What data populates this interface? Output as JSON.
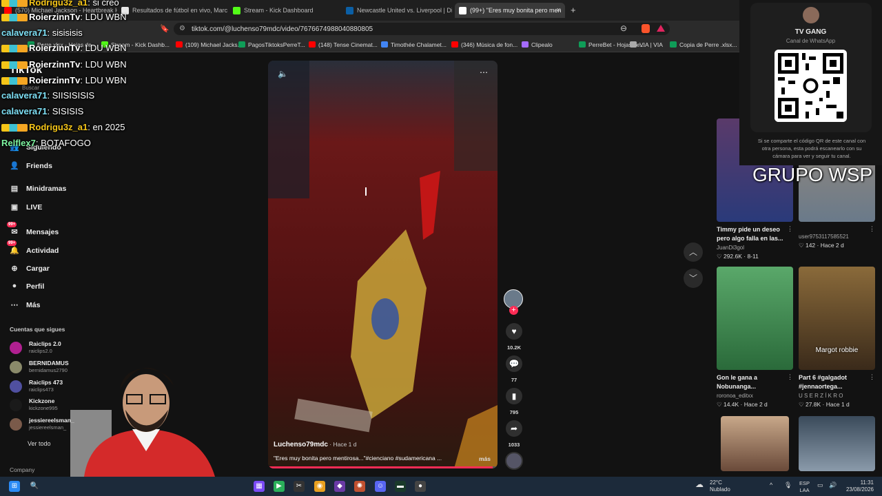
{
  "browser": {
    "tabs": [
      {
        "title": "(570) Michael Jackson - Heartbreak H",
        "favicon_color": "#ff0000"
      },
      {
        "title": "Resultados de fútbol en vivo, Marcad",
        "favicon_color": "#e8e8e8"
      },
      {
        "title": "Stream - Kick Dashboard",
        "favicon_color": "#53fc18"
      },
      {
        "title": "Newcastle United vs. Liverpool | Disne",
        "favicon_color": "#0b5fa5"
      },
      {
        "title": "(99+) \"Eres muy bonita pero men",
        "favicon_color": "#ffffff",
        "active": true
      }
    ],
    "url": "tiktok.com/@luchenso79mdc/video/7676674988040880805",
    "bookmarks": [
      {
        "label": "Perre.xlsx - Hojas de...",
        "color": "#0f9d58"
      },
      {
        "label": "Stream - Kick Dashb...",
        "color": "#53fc18"
      },
      {
        "label": "(109) Michael Jacks...",
        "color": "#ff0000"
      },
      {
        "label": "PagosTiktoksPerreT...",
        "color": "#0f9d58"
      },
      {
        "label": "(148) Tense Cinemat...",
        "color": "#ff0000"
      },
      {
        "label": "Timothée Chalamet...",
        "color": "#4285f4"
      },
      {
        "label": "(346) Música de fon...",
        "color": "#ff0000"
      },
      {
        "label": "Clipealo",
        "color": "#a66cff"
      },
      {
        "label": "PerreBet - Hojas de...",
        "color": "#0f9d58"
      },
      {
        "label": "VIA | VIA",
        "color": "#aaaaaa"
      },
      {
        "label": "Copia de Perre .xlsx...",
        "color": "#0f9d58"
      }
    ]
  },
  "chat": [
    {
      "user": "Rodrigu3z_a1",
      "text": ": si creo",
      "color": "#f5c518",
      "badges": true
    },
    {
      "user": "calavera71",
      "text": ": sisisisis",
      "color": "#7ee0f5",
      "badges": false
    },
    {
      "user": "RoierzinnTv",
      "text": ": LDU WBN",
      "color": "#ffffff",
      "badges": true
    },
    {
      "user": "RoierzinnTv",
      "text": ": LDU WBN",
      "color": "#ffffff",
      "badges": true
    },
    {
      "user": "RoierzinnTv",
      "text": ": LDU WBN",
      "color": "#ffffff",
      "badges": true
    },
    {
      "user": "RoierzinnTv",
      "text": ": LDU WBN",
      "color": "#ffffff",
      "badges": true
    },
    {
      "user": "calavera71",
      "text": ": SIISISISIS",
      "color": "#7ee0f5",
      "badges": false
    },
    {
      "user": "calavera71",
      "text": ": SISISIS",
      "color": "#7ee0f5",
      "badges": false
    },
    {
      "user": "Rodrigu3z_a1",
      "text": ": en 2025",
      "color": "#f5c518",
      "badges": true
    },
    {
      "user": "Relflex7",
      "text": ": BOTAFOGO",
      "color": "#7ef5a0",
      "badges": false
    }
  ],
  "tiktok": {
    "logo": "TikTok",
    "search_placeholder": "Buscar",
    "nav": [
      {
        "label": "Siguiendo",
        "icon": "following-icon"
      },
      {
        "label": "Friends",
        "icon": "friends-icon"
      },
      {
        "label": "Minidramas",
        "icon": "minidramas-icon"
      },
      {
        "label": "LIVE",
        "icon": "live-icon"
      },
      {
        "label": "Mensajes",
        "icon": "messages-icon",
        "badge": "99+"
      },
      {
        "label": "Actividad",
        "icon": "activity-icon",
        "badge": "99+"
      },
      {
        "label": "Cargar",
        "icon": "upload-icon"
      },
      {
        "label": "Perfil",
        "icon": "profile-icon"
      },
      {
        "label": "Más",
        "icon": "more-icon"
      }
    ],
    "following_header": "Cuentas que sigues",
    "following": [
      {
        "name": "Raiclips 2.0",
        "handle": "raiclips2.0",
        "color": "#b02090"
      },
      {
        "name": "BERNIDAMUS",
        "handle": "bernidamus2790",
        "color": "#8a8a6a"
      },
      {
        "name": "Raiclips 473",
        "handle": "raiclips473",
        "color": "#5050a0"
      },
      {
        "name": "Kickzone",
        "handle": "kickzone995",
        "color": "#1a1a1a"
      },
      {
        "name": "jessiereelsman_",
        "handle": "jessiereelsman_",
        "color": "#7a5a4a"
      }
    ],
    "see_all": "Ver todo",
    "company": "Company",
    "video": {
      "author": "Luchenso79mdc",
      "age": " · Hace 1 d",
      "caption": "\"Eres muy bonita pero mentirosa...\"#cienciano #sudamericana ...",
      "more": "más",
      "likes": "10.2K",
      "comments": "77",
      "saves": "795",
      "shares": "1033",
      "progress": 0.98
    },
    "recommended": [
      {
        "title": "Timmy pide un deseo pero algo falla en las...",
        "author": "JuanDi3gol",
        "stats": "♡ 292.6K · 8-11",
        "overlay": ""
      },
      {
        "title": "",
        "author": "user9753117585521",
        "stats": "♡ 142 · Hace 2 d",
        "overlay": ""
      },
      {
        "title": "Gon le gana a Nobunanga...",
        "author": "roronoa_editxx",
        "stats": "♡ 14.4K · Hace 2 d",
        "overlay": ""
      },
      {
        "title": "Part 6 #galgadot #jennaortega...",
        "author": "U S E R Z Í K R O",
        "stats": "♡ 27.8K · Hace 1 d",
        "overlay": "Margot robbie"
      }
    ]
  },
  "whatsapp": {
    "title": "TV GANG",
    "subtitle": "Canal de WhatsApp",
    "description": "Si se comparte el código QR de este canal con otra persona, esta podrá escanearlo con su cámara para ver y seguir tu canal."
  },
  "overlay_text": "GRUPO WSP",
  "taskbar": {
    "temp": "22°C",
    "condition": "Nublado",
    "lang1": "ESP",
    "lang2": "LAA",
    "time": "11:31",
    "date": "23/08/2026"
  }
}
